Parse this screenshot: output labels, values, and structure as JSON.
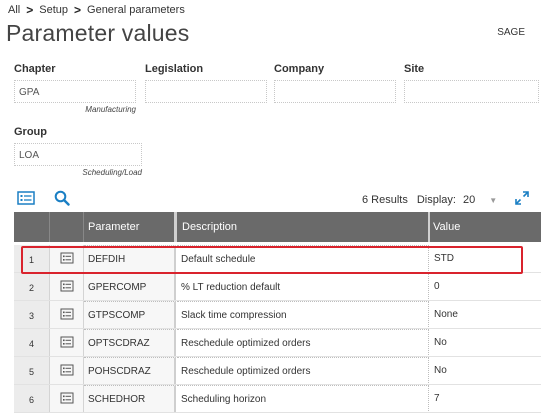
{
  "breadcrumb": {
    "items": [
      "All",
      "Setup",
      "General parameters"
    ],
    "separator": ">"
  },
  "page": {
    "title": "Parameter values",
    "company_code": "SAGE"
  },
  "filters": {
    "chapter": {
      "label": "Chapter",
      "value": "GPA",
      "subtitle": "Manufacturing"
    },
    "legislation": {
      "label": "Legislation",
      "value": ""
    },
    "company": {
      "label": "Company",
      "value": ""
    },
    "site": {
      "label": "Site",
      "value": ""
    },
    "group": {
      "label": "Group",
      "value": "LOA",
      "subtitle": "Scheduling/Load"
    }
  },
  "toolbar": {
    "results_text": "6 Results",
    "display_label": "Display:",
    "display_value": "20"
  },
  "grid": {
    "columns": [
      "Parameter",
      "Description",
      "Value"
    ],
    "rows": [
      {
        "num": "1",
        "parameter": "DEFDIH",
        "description": "Default schedule",
        "value": "STD"
      },
      {
        "num": "2",
        "parameter": "GPERCOMP",
        "description": "% LT reduction default",
        "value": "0"
      },
      {
        "num": "3",
        "parameter": "GTPSCOMP",
        "description": "Slack time compression",
        "value": "None"
      },
      {
        "num": "4",
        "parameter": "OPTSCDRAZ",
        "description": "Reschedule optimized orders",
        "value": "No"
      },
      {
        "num": "5",
        "parameter": "POHSCDRAZ",
        "description": "Reschedule optimized orders",
        "value": "No"
      },
      {
        "num": "6",
        "parameter": "SCHEDHOR",
        "description": "Scheduling horizon",
        "value": "7"
      }
    ]
  },
  "colors": {
    "header_bg": "#6a6a6a",
    "highlight": "#d9232d",
    "accent_blue": "#1a7fc4"
  }
}
